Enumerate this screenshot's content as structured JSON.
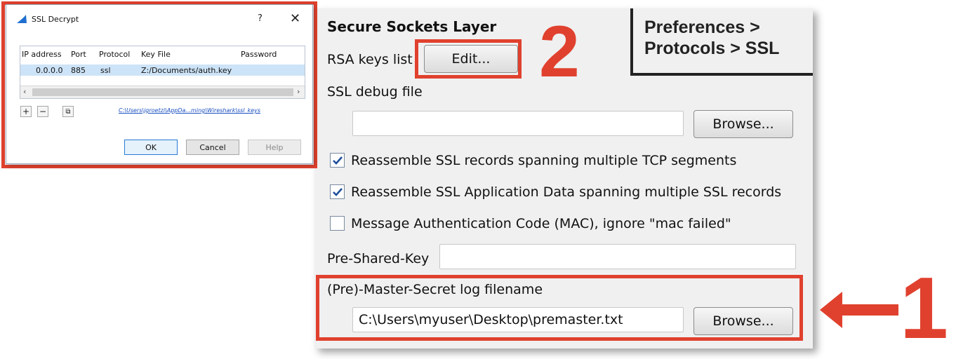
{
  "dialog": {
    "title": "SSL Decrypt",
    "help_glyph": "?",
    "close_glyph": "✕",
    "columns": [
      "IP address",
      "Port",
      "Protocol",
      "Key File",
      "Password"
    ],
    "rows": [
      {
        "ip": "0.0.0.0",
        "port": "885",
        "protocol": "ssl",
        "key_file": "Z:/Documents/auth.key",
        "password": ""
      }
    ],
    "add_glyph": "+",
    "remove_glyph": "−",
    "copy_glyph": "⧉",
    "keys_path": "C:\\Users\\jgroetzi\\AppDa...ming\\Wireshark\\ssl_keys",
    "ok_label": "OK",
    "cancel_label": "Cancel",
    "help_label": "Help"
  },
  "prefs": {
    "section_title": "Secure Sockets Layer",
    "rsa_keys_label": "RSA keys list",
    "edit_button": "Edit...",
    "ssl_debug_label": "SSL debug file",
    "ssl_debug_value": "",
    "browse_label": "Browse...",
    "checkboxes": [
      {
        "label": "Reassemble SSL records spanning multiple TCP segments",
        "checked": true
      },
      {
        "label": "Reassemble SSL Application Data spanning multiple SSL records",
        "checked": true
      },
      {
        "label": "Message Authentication Code (MAC), ignore \"mac failed\"",
        "checked": false
      }
    ],
    "psk_label": "Pre-Shared-Key",
    "psk_value": "",
    "master_secret_label": "(Pre)-Master-Secret log filename",
    "master_secret_value": "C:\\Users\\myuser\\Desktop\\premaster.txt",
    "browse2_label": "Browse..."
  },
  "breadcrumb": {
    "line1": "Preferences >",
    "line2": "Protocols > SSL"
  },
  "annotations": {
    "number_1": "1",
    "number_2": "2",
    "accent_color": "#e0412e"
  }
}
